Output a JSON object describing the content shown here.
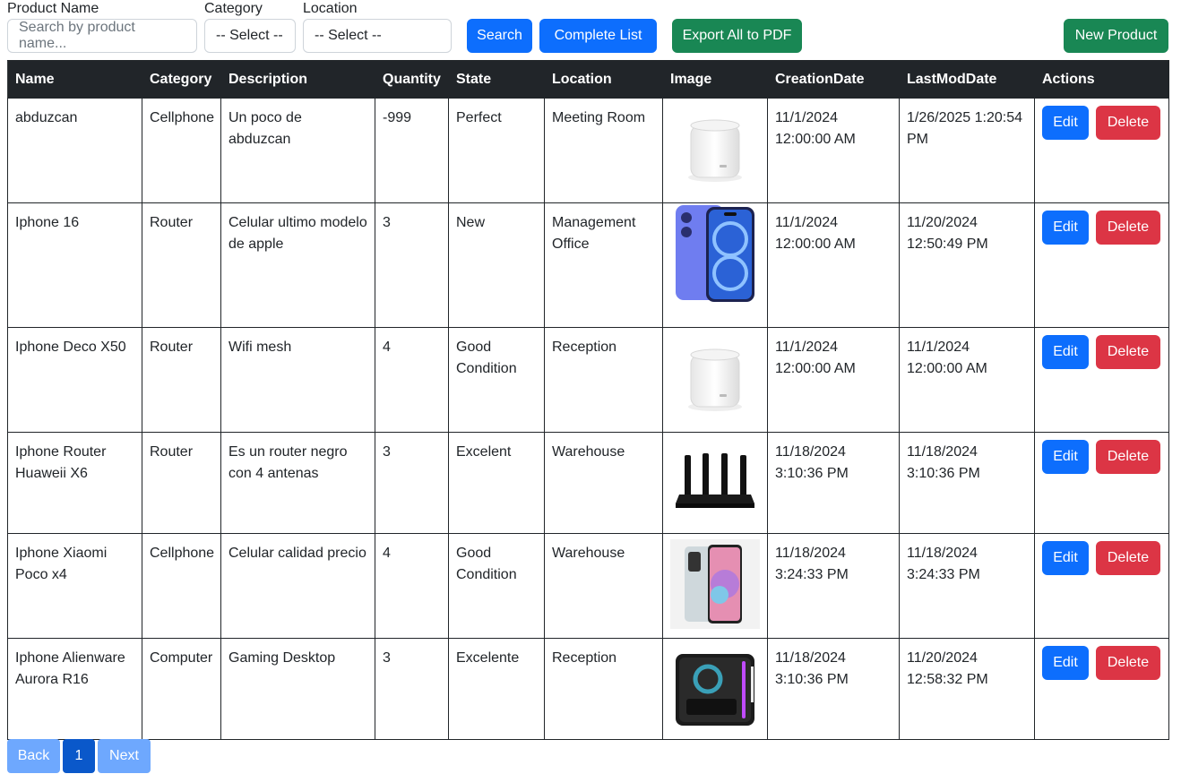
{
  "filters": {
    "product_name": {
      "label": "Product Name",
      "placeholder": "Search by product name..."
    },
    "category": {
      "label": "Category",
      "value": "-- Select --"
    },
    "location": {
      "label": "Location",
      "value": "-- Select --"
    },
    "search_label": "Search",
    "complete_list_label": "Complete List",
    "export_label": "Export All to PDF",
    "new_product_label": "New Product"
  },
  "table": {
    "headers": [
      "Name",
      "Category",
      "Description",
      "Quantity",
      "State",
      "Location",
      "Image",
      "CreationDate",
      "LastModDate",
      "Actions"
    ],
    "rows": [
      {
        "name": "abduzcan",
        "category": "Cellphone",
        "description": "Un poco de abduzcan",
        "quantity": "-999",
        "state": "Perfect",
        "location": "Meeting Room",
        "image": "mesh-wifi-unit",
        "creation_date": "11/1/2024 12:00:00 AM",
        "last_mod_date": "1/26/2025 1:20:54 PM"
      },
      {
        "name": "Iphone 16",
        "category": "Router",
        "description": "Celular ultimo modelo de apple",
        "quantity": "3",
        "state": "New",
        "location": "Management Office",
        "image": "iphone-16",
        "creation_date": "11/1/2024 12:00:00 AM",
        "last_mod_date": "11/20/2024 12:50:49 PM"
      },
      {
        "name": "Iphone Deco X50",
        "category": "Router",
        "description": "Wifi mesh",
        "quantity": "4",
        "state": "Good Condition",
        "location": "Reception",
        "image": "mesh-wifi-unit",
        "creation_date": "11/1/2024 12:00:00 AM",
        "last_mod_date": "11/1/2024 12:00:00 AM"
      },
      {
        "name": "Iphone Router Huaweii X6",
        "category": "Router",
        "description": "Es un router negro con 4 antenas",
        "quantity": "3",
        "state": "Excelent",
        "location": "Warehouse",
        "image": "black-router",
        "creation_date": "11/18/2024 3:10:36 PM",
        "last_mod_date": "11/18/2024 3:10:36 PM"
      },
      {
        "name": "Iphone Xiaomi Poco x4",
        "category": "Cellphone",
        "description": "Celular calidad precio",
        "quantity": "4",
        "state": "Good Condition",
        "location": "Warehouse",
        "image": "android-phone",
        "creation_date": "11/18/2024 3:24:33 PM",
        "last_mod_date": "11/18/2024 3:24:33 PM"
      },
      {
        "name": "Iphone Alienware Aurora R16",
        "category": "Computer",
        "description": "Gaming Desktop",
        "quantity": "3",
        "state": "Excelente",
        "location": "Reception",
        "image": "gaming-desktop",
        "creation_date": "11/18/2024 3:10:36 PM",
        "last_mod_date": "11/20/2024 12:58:32 PM"
      }
    ],
    "edit_label": "Edit",
    "delete_label": "Delete"
  },
  "pagination": {
    "back_label": "Back",
    "current_page": "1",
    "next_label": "Next"
  },
  "colors": {
    "primary": "#0d6efd",
    "success": "#198754",
    "danger": "#dc3545",
    "header_dark": "#212529"
  }
}
